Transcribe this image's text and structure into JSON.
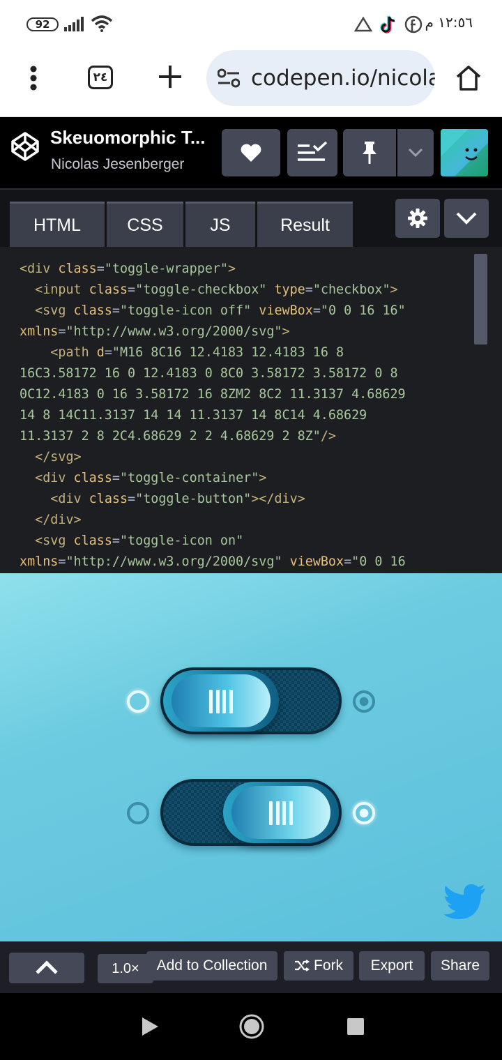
{
  "status_bar": {
    "battery": "92",
    "time": "١٢:٥٦ م"
  },
  "browser": {
    "tab_count": "٢٤",
    "url": "codepen.io/nicolas",
    "icons": [
      "more-vert-icon",
      "tabs-icon",
      "plus-icon",
      "site-settings-icon",
      "home-icon"
    ]
  },
  "header": {
    "title": "Skeuomorphic T...",
    "author": "Nicolas Jesenberger"
  },
  "editor": {
    "tabs": [
      "HTML",
      "CSS",
      "JS",
      "Result"
    ],
    "active_tab": "Result"
  },
  "code_lines": [
    [
      {
        "c": "tag",
        "t": "<div "
      },
      {
        "c": "attr",
        "t": "class"
      },
      {
        "c": "p",
        "t": "="
      },
      {
        "c": "str",
        "t": "\"toggle-wrapper\""
      },
      {
        "c": "tag",
        "t": ">"
      }
    ],
    [
      {
        "c": "p",
        "t": "  "
      },
      {
        "c": "tag",
        "t": "<input "
      },
      {
        "c": "attr",
        "t": "class"
      },
      {
        "c": "p",
        "t": "="
      },
      {
        "c": "str",
        "t": "\"toggle-checkbox\""
      },
      {
        "c": "p",
        "t": " "
      },
      {
        "c": "attr",
        "t": "type"
      },
      {
        "c": "p",
        "t": "="
      },
      {
        "c": "str",
        "t": "\"checkbox\""
      },
      {
        "c": "tag",
        "t": ">"
      }
    ],
    [
      {
        "c": "p",
        "t": "  "
      },
      {
        "c": "tag",
        "t": "<svg "
      },
      {
        "c": "attr",
        "t": "class"
      },
      {
        "c": "p",
        "t": "="
      },
      {
        "c": "str",
        "t": "\"toggle-icon off\""
      },
      {
        "c": "p",
        "t": " "
      },
      {
        "c": "attr",
        "t": "viewBox"
      },
      {
        "c": "p",
        "t": "="
      },
      {
        "c": "str",
        "t": "\"0 0 16 16\""
      }
    ],
    [
      {
        "c": "attr",
        "t": "xmlns"
      },
      {
        "c": "p",
        "t": "="
      },
      {
        "c": "str",
        "t": "\"http://www.w3.org/2000/svg\""
      },
      {
        "c": "tag",
        "t": ">"
      }
    ],
    [
      {
        "c": "p",
        "t": "    "
      },
      {
        "c": "tag",
        "t": "<path "
      },
      {
        "c": "attr",
        "t": "d"
      },
      {
        "c": "p",
        "t": "="
      },
      {
        "c": "str",
        "t": "\"M16 8C16 12.4183 12.4183 16 8"
      }
    ],
    [
      {
        "c": "str",
        "t": "16C3.58172 16 0 12.4183 0 8C0 3.58172 3.58172 0 8"
      }
    ],
    [
      {
        "c": "str",
        "t": "0C12.4183 0 16 3.58172 16 8ZM2 8C2 11.3137 4.68629"
      }
    ],
    [
      {
        "c": "str",
        "t": "14 8 14C11.3137 14 14 11.3137 14 8C14 4.68629"
      }
    ],
    [
      {
        "c": "str",
        "t": "11.3137 2 8 2C4.68629 2 2 4.68629 2 8Z\""
      },
      {
        "c": "tag",
        "t": "/>"
      }
    ],
    [
      {
        "c": "p",
        "t": "  "
      },
      {
        "c": "tag",
        "t": "</svg>"
      }
    ],
    [
      {
        "c": "p",
        "t": "  "
      },
      {
        "c": "tag",
        "t": "<div "
      },
      {
        "c": "attr",
        "t": "class"
      },
      {
        "c": "p",
        "t": "="
      },
      {
        "c": "str",
        "t": "\"toggle-container\""
      },
      {
        "c": "tag",
        "t": ">"
      }
    ],
    [
      {
        "c": "p",
        "t": "    "
      },
      {
        "c": "tag",
        "t": "<div "
      },
      {
        "c": "attr",
        "t": "class"
      },
      {
        "c": "p",
        "t": "="
      },
      {
        "c": "str",
        "t": "\"toggle-button\""
      },
      {
        "c": "tag",
        "t": "></div>"
      }
    ],
    [
      {
        "c": "p",
        "t": "  "
      },
      {
        "c": "tag",
        "t": "</div>"
      }
    ],
    [
      {
        "c": "p",
        "t": "  "
      },
      {
        "c": "tag",
        "t": "<svg "
      },
      {
        "c": "attr",
        "t": "class"
      },
      {
        "c": "p",
        "t": "="
      },
      {
        "c": "str",
        "t": "\"toggle-icon on\""
      }
    ],
    [
      {
        "c": "attr",
        "t": "xmlns"
      },
      {
        "c": "p",
        "t": "="
      },
      {
        "c": "str",
        "t": "\"http://www.w3.org/2000/svg\""
      },
      {
        "c": "p",
        "t": " "
      },
      {
        "c": "attr",
        "t": "viewBox"
      },
      {
        "c": "p",
        "t": "="
      },
      {
        "c": "str",
        "t": "\"0 0 16"
      }
    ]
  ],
  "result": {
    "toggles": [
      {
        "state": "off"
      },
      {
        "state": "on"
      }
    ]
  },
  "bottom_bar": {
    "zoom": "1.0×",
    "add_to_collection": "Add to Collection",
    "fork": "Fork",
    "export": "Export",
    "share": "Share"
  },
  "colors": {
    "accent_twitter": "#1da1f2",
    "panel": "#444857",
    "code_bg": "#1d1e22"
  }
}
